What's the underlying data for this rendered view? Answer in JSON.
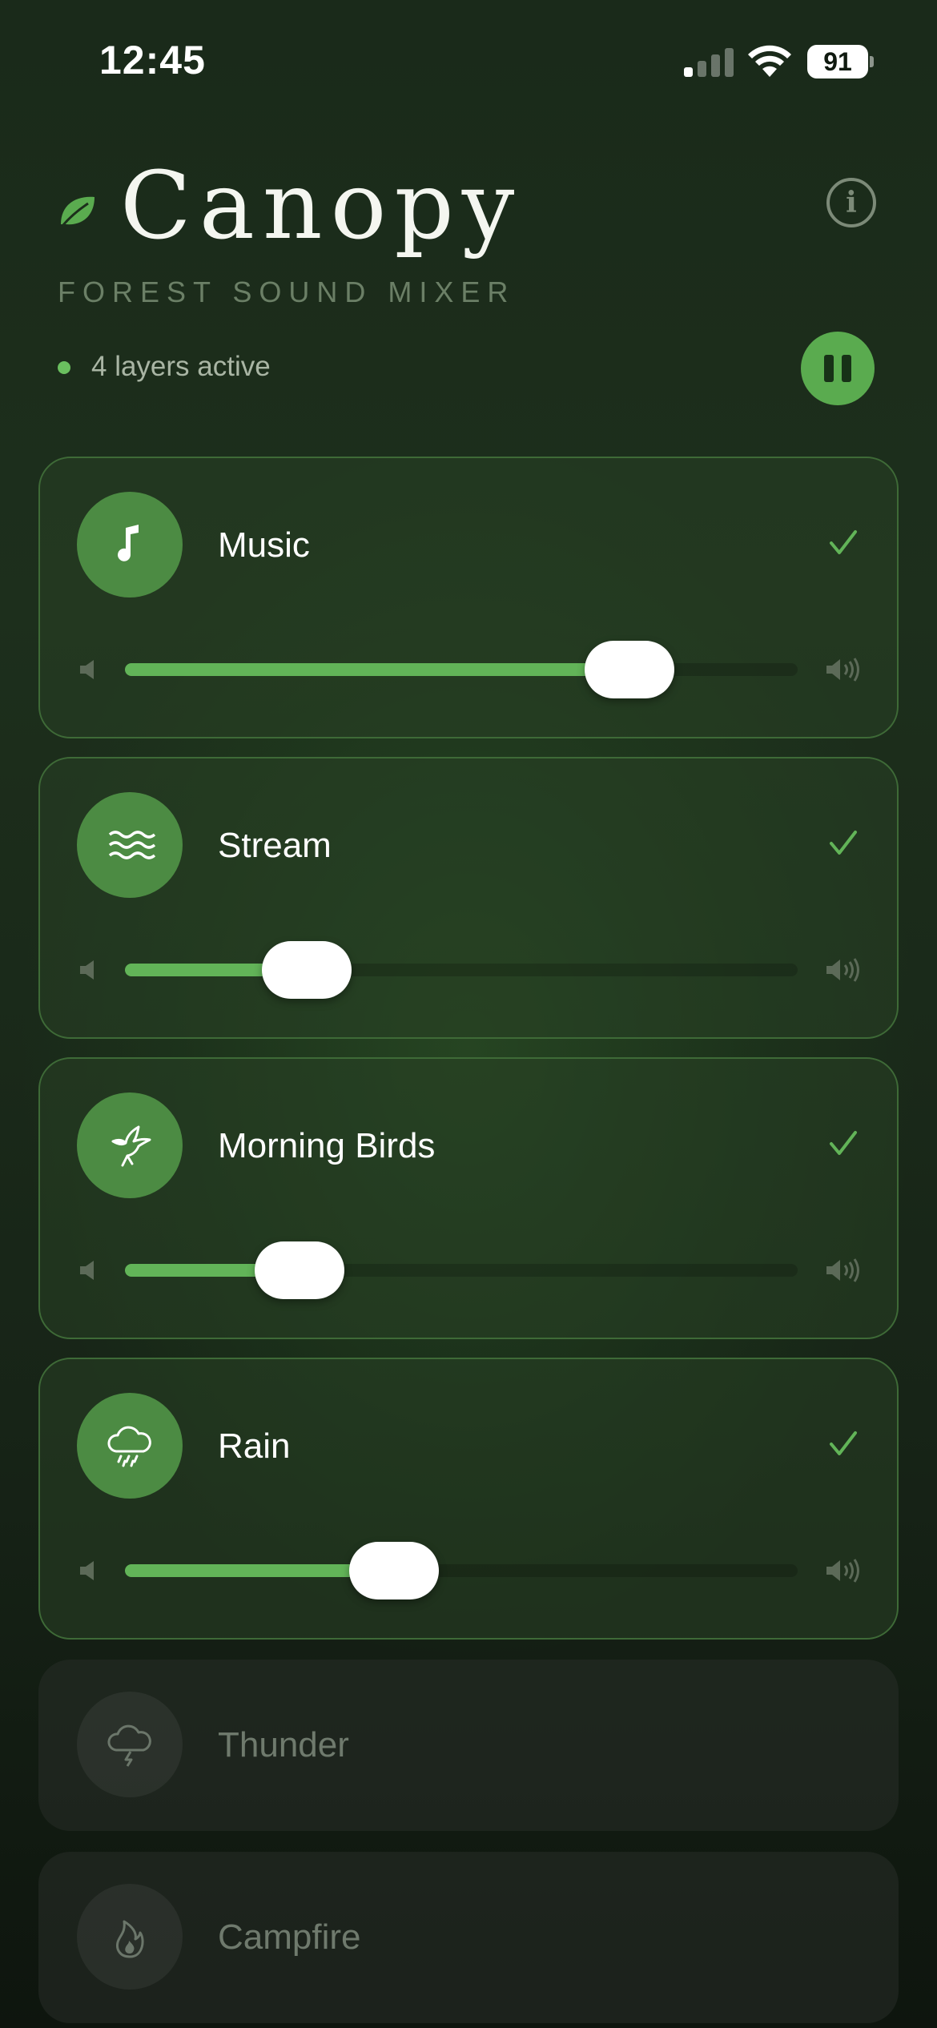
{
  "status_bar": {
    "time": "12:45",
    "battery": "91"
  },
  "header": {
    "title": "Canopy",
    "subtitle": "FOREST SOUND MIXER",
    "active_text": "4 layers active"
  },
  "colors": {
    "accent": "#5aab4f",
    "fill": "#62b458",
    "card_active_border": "#3e6a37"
  },
  "layers": [
    {
      "label": "Music",
      "icon": "music-note-icon",
      "active": true,
      "volume": 0.75
    },
    {
      "label": "Stream",
      "icon": "waves-icon",
      "active": true,
      "volume": 0.27
    },
    {
      "label": "Morning Birds",
      "icon": "bird-icon",
      "active": true,
      "volume": 0.26
    },
    {
      "label": "Rain",
      "icon": "rain-cloud-icon",
      "active": true,
      "volume": 0.4
    },
    {
      "label": "Thunder",
      "icon": "thunder-cloud-icon",
      "active": false
    },
    {
      "label": "Campfire",
      "icon": "flame-icon",
      "active": false
    }
  ]
}
